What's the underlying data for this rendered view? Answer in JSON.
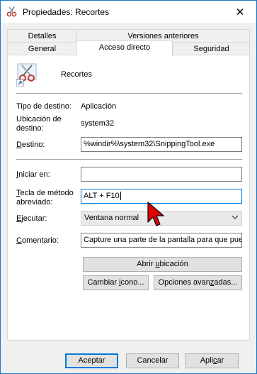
{
  "window": {
    "title": "Propiedades: Recortes",
    "close_glyph": "✕",
    "accent": "#1979ca"
  },
  "tabs": {
    "row1": [
      "Detalles",
      "Versiones anteriores"
    ],
    "row2": [
      "General",
      "Acceso directo",
      "Seguridad"
    ],
    "active": "Acceso directo"
  },
  "shortcut": {
    "name": "Recortes",
    "icon": "snipping-tool-scissors-icon"
  },
  "fields": {
    "target_type_label": "Tipo de destino:",
    "target_type_value": "Aplicación",
    "target_location_label_1": "Ubicación de",
    "target_location_label_2": "destino:",
    "target_location_value": "system32",
    "target_label_pre": "D",
    "target_label_post": "estino:",
    "target_value": "%windir%\\system32\\SnippingTool.exe",
    "start_in_label_pre": "I",
    "start_in_label_post": "niciar en:",
    "start_in_value": "",
    "hotkey_label_1_pre": "T",
    "hotkey_label_1_post": "ecla de método",
    "hotkey_label_2": "abreviado:",
    "hotkey_value": "ALT + F10",
    "run_label_pre": "E",
    "run_label_post": "jecutar:",
    "run_value": "Ventana normal",
    "comment_label_pre": "C",
    "comment_label_post": "omentario:",
    "comment_value": "Capture una parte de la pantalla para que pueda"
  },
  "buttons": {
    "open_location_pre": "Abrir ",
    "open_location_u": "u",
    "open_location_post": "bicación",
    "change_icon_pre": "Cambiar ",
    "change_icon_u": "i",
    "change_icon_post": "cono...",
    "advanced_pre": "Opciones avan",
    "advanced_u": "z",
    "advanced_post": "adas...",
    "ok": "Aceptar",
    "cancel": "Cancelar",
    "apply_pre": "Apli",
    "apply_u": "c",
    "apply_post": "ar"
  },
  "cursor": {
    "color": "#e00000"
  }
}
